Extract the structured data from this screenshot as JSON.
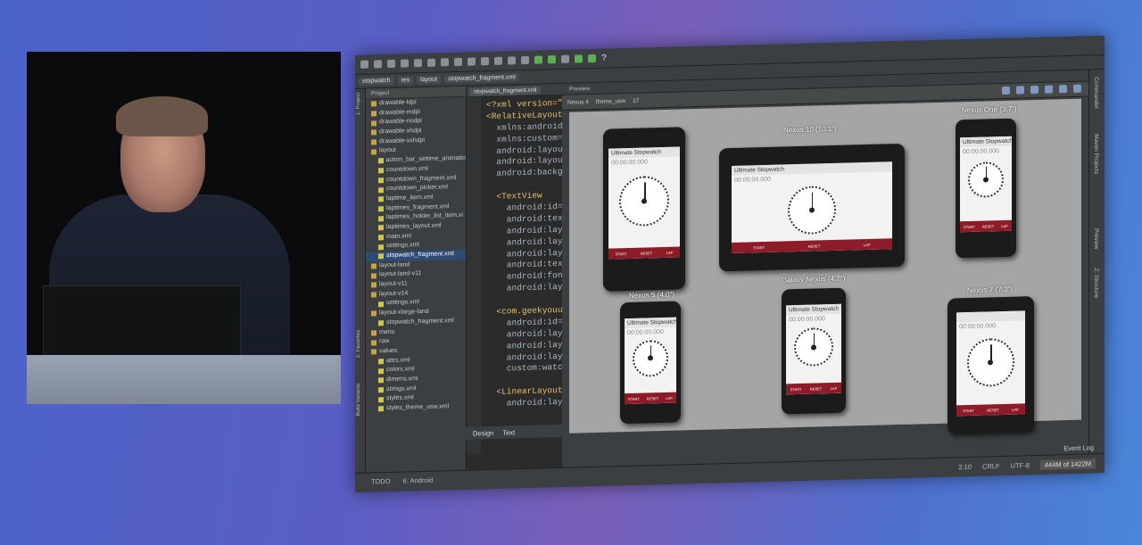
{
  "toolbar": {
    "help_icon": "question-icon"
  },
  "breadcrumb": [
    "stopwatch",
    "res",
    "layout",
    "stopwatch_fragment.xml"
  ],
  "sidebar_left": {
    "project_label": "1: Project",
    "favorites_label": "2: Favorites",
    "build_variants_label": "Build Variants"
  },
  "project": {
    "header": "Project",
    "items": [
      {
        "label": "drawable-ldpi",
        "type": "folder",
        "indent": 0
      },
      {
        "label": "drawable-mdpi",
        "type": "folder",
        "indent": 0
      },
      {
        "label": "drawable-nodpi",
        "type": "folder",
        "indent": 0
      },
      {
        "label": "drawable-xhdpi",
        "type": "folder",
        "indent": 0
      },
      {
        "label": "drawable-xxhdpi",
        "type": "folder",
        "indent": 0
      },
      {
        "label": "layout",
        "type": "folder",
        "indent": 0
      },
      {
        "label": "action_bar_settime_animatio",
        "type": "xml",
        "indent": 1
      },
      {
        "label": "countdown.xml",
        "type": "xml",
        "indent": 1
      },
      {
        "label": "countdown_fragment.xml",
        "type": "xml",
        "indent": 1
      },
      {
        "label": "countdown_picker.xml",
        "type": "xml",
        "indent": 1
      },
      {
        "label": "laptime_item.xml",
        "type": "xml",
        "indent": 1
      },
      {
        "label": "laptimes_fragment.xml",
        "type": "xml",
        "indent": 1
      },
      {
        "label": "laptimes_holder_list_item.xi",
        "type": "xml",
        "indent": 1
      },
      {
        "label": "laptimes_layout.xml",
        "type": "xml",
        "indent": 1
      },
      {
        "label": "main.xml",
        "type": "xml",
        "indent": 1
      },
      {
        "label": "settings.xml",
        "type": "xml",
        "indent": 1
      },
      {
        "label": "stopwatch_fragment.xml",
        "type": "xml",
        "indent": 1,
        "selected": true
      },
      {
        "label": "layout-land",
        "type": "folder",
        "indent": 0
      },
      {
        "label": "layout-land-v11",
        "type": "folder",
        "indent": 0
      },
      {
        "label": "layout-v11",
        "type": "folder",
        "indent": 0
      },
      {
        "label": "layout-v14",
        "type": "folder",
        "indent": 0
      },
      {
        "label": "settings.xml",
        "type": "xml",
        "indent": 1
      },
      {
        "label": "layout-xlarge-land",
        "type": "folder",
        "indent": 0
      },
      {
        "label": "stopwatch_fragment.xml",
        "type": "xml",
        "indent": 1
      },
      {
        "label": "menu",
        "type": "folder",
        "indent": 0
      },
      {
        "label": "raw",
        "type": "folder",
        "indent": 0
      },
      {
        "label": "values",
        "type": "folder",
        "indent": 0
      },
      {
        "label": "attrs.xml",
        "type": "xml",
        "indent": 1
      },
      {
        "label": "colors.xml",
        "type": "xml",
        "indent": 1
      },
      {
        "label": "dimens.xml",
        "type": "xml",
        "indent": 1
      },
      {
        "label": "strings.xml",
        "type": "xml",
        "indent": 1
      },
      {
        "label": "styles.xml",
        "type": "xml",
        "indent": 1
      },
      {
        "label": "styles_theme_usw.xml",
        "type": "xml",
        "indent": 1
      }
    ]
  },
  "editor": {
    "tab": "stopwatch_fragment.xml",
    "lines": [
      "<?xml version=\"",
      "<RelativeLayout",
      "  xmlns:android=",
      "  xmlns:custom=",
      "  android:layou",
      "  android:layou",
      "  android:backg",
      "",
      "  <TextView",
      "    android:id=",
      "    android:tex",
      "    android:lay",
      "    android:lay",
      "    android:lay",
      "    android:tex",
      "    android:fon",
      "    android:lay",
      "",
      "  <com.geekyouu",
      "    android:id=",
      "    android:lay",
      "    android:lay",
      "    android:lay",
      "    custom:watc",
      "",
      "  <LinearLayout",
      "    android:lay"
    ],
    "design_tab": "Design",
    "text_tab": "Text"
  },
  "preview": {
    "header": "Preview",
    "device_menu": "Nexus 4",
    "theme": "theme_usw",
    "api": "17",
    "devices": [
      {
        "name": "",
        "title": "Ultimate Stopwatch",
        "time": "00:00:00.000",
        "kind": "phone"
      },
      {
        "name": "Nexus 10 (10.1\")",
        "title": "Ultimate Stopwatch",
        "time": "00:00:00.000",
        "kind": "tablet"
      },
      {
        "name": "Nexus One (3.7\")",
        "title": "Ultimate Stopwatch",
        "time": "00:00:00.000",
        "kind": "phone"
      },
      {
        "name": "Nexus 5 (4.0\")",
        "title": "Ultimate Stopwatch",
        "time": "00:00:00.000",
        "kind": "phone"
      },
      {
        "name": "Galaxy Nexus (4.7\")",
        "title": "Ultimate Stopwatch",
        "time": "00:00:00.000",
        "kind": "phone"
      },
      {
        "name": "Nexus 7 (7.3\")",
        "title": "",
        "time": "00:00:00.000",
        "kind": "tablet7"
      }
    ],
    "buttons": [
      "START",
      "RESET",
      "LAP"
    ]
  },
  "sidebar_right": {
    "commander": "Commander",
    "maven": "Maven Projects",
    "preview": "Preview",
    "structure": "Z: Structure"
  },
  "statusbar": {
    "todo": "TODO",
    "android": "6: Android",
    "event_log": "Event Log",
    "position": "2:10",
    "line_sep": "CRLF",
    "encoding": "UTF-8",
    "memory": "444M of 1422M"
  }
}
